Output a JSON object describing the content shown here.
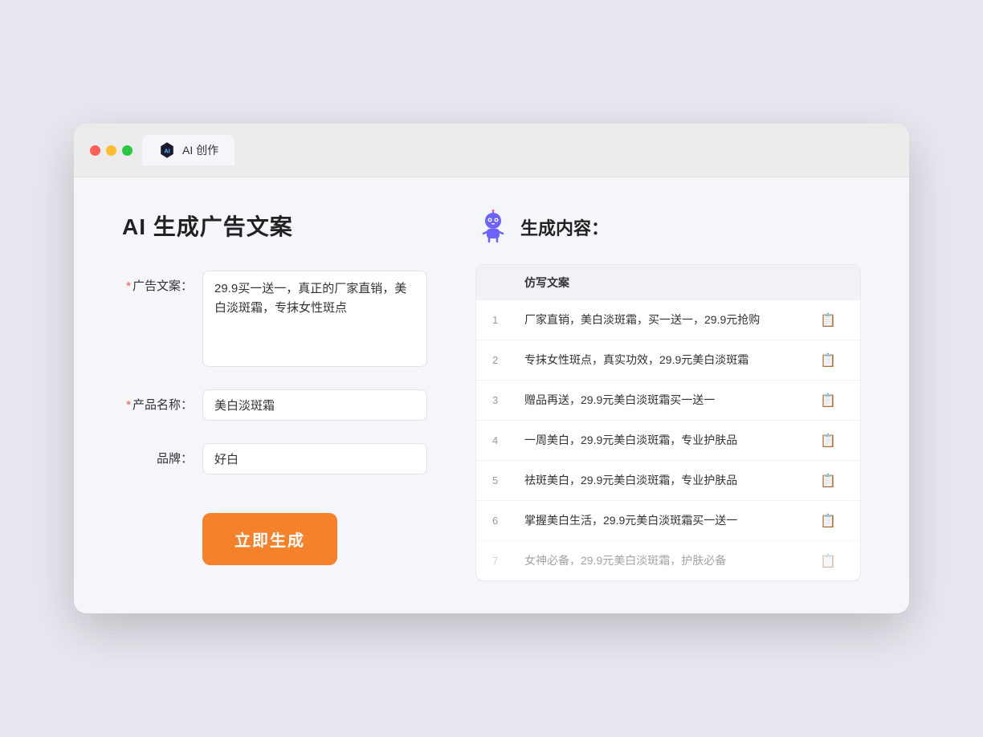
{
  "window": {
    "tab_label": "AI 创作"
  },
  "left": {
    "title": "AI 生成广告文案",
    "form": {
      "ad_copy_label": "广告文案：",
      "ad_copy_value": "29.9买一送一，真正的厂家直销，美白淡斑霜，专抹女性斑点",
      "product_label": "产品名称：",
      "product_value": "美白淡斑霜",
      "brand_label": "品牌：",
      "brand_value": "好白",
      "generate_btn": "立即生成"
    }
  },
  "right": {
    "title": "生成内容：",
    "table_header": "仿写文案",
    "rows": [
      {
        "num": "1",
        "text": "厂家直销，美白淡斑霜，买一送一，29.9元抢购",
        "dimmed": false
      },
      {
        "num": "2",
        "text": "专抹女性斑点，真实功效，29.9元美白淡斑霜",
        "dimmed": false
      },
      {
        "num": "3",
        "text": "赠品再送，29.9元美白淡斑霜买一送一",
        "dimmed": false
      },
      {
        "num": "4",
        "text": "一周美白，29.9元美白淡斑霜，专业护肤品",
        "dimmed": false
      },
      {
        "num": "5",
        "text": "祛斑美白，29.9元美白淡斑霜，专业护肤品",
        "dimmed": false
      },
      {
        "num": "6",
        "text": "掌握美白生活，29.9元美白淡斑霜买一送一",
        "dimmed": false
      },
      {
        "num": "7",
        "text": "女神必备，29.9元美白淡斑霜，护肤必备",
        "dimmed": true
      }
    ]
  }
}
